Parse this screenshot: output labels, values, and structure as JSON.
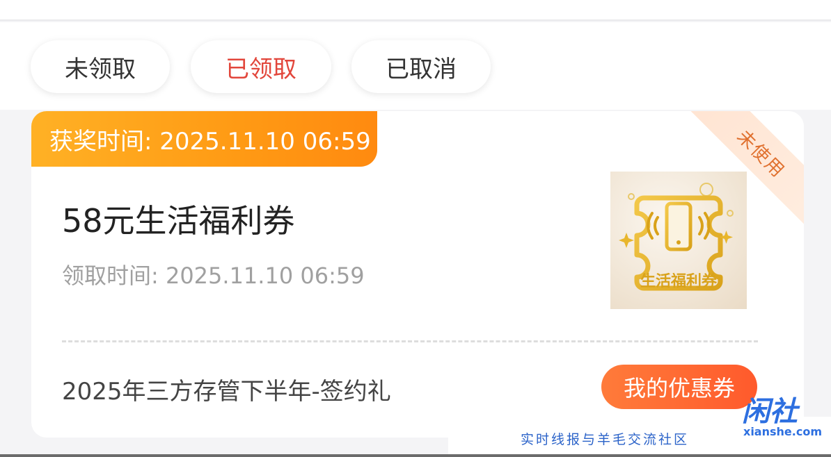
{
  "tabs": [
    {
      "label": "未领取",
      "active": false
    },
    {
      "label": "已领取",
      "active": true
    },
    {
      "label": "已取消",
      "active": false
    }
  ],
  "card": {
    "prize_time": "获奖时间: 2025.11.10 06:59",
    "status_ribbon": "未使用",
    "title": "58元生活福利券",
    "claim_time": "领取时间: 2025.11.10 06:59",
    "image_caption": "生活福利券",
    "activity": "2025年三方存管下半年-签约礼",
    "action_button": "我的优惠券"
  },
  "watermark": {
    "caption": "实时线报与羊毛交流社区",
    "logo": "闲社",
    "url": "xianshe.com"
  },
  "colors": {
    "accent_red": "#e2463b",
    "banner_orange": "#ff9a14",
    "button_orange": "#ff5a2c",
    "watermark_blue": "#2d6fe0"
  }
}
